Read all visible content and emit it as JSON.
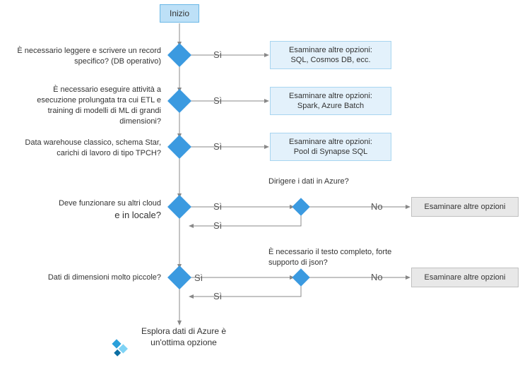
{
  "start": "Inizio",
  "q1": "È necessario leggere e scrivere un record specifico? (DB operativo)",
  "q2": "È necessario eseguire attività a esecuzione prolungata tra cui ETL e training di modelli di ML di grandi dimensioni?",
  "q3": "Data warehouse classico, schema Star, carichi di lavoro di tipo TPCH?",
  "q4_l1": "Deve funzionare su altri cloud",
  "q4_l2": "e in locale?",
  "q4b": "Dirigere i dati in Azure?",
  "q5": "Dati di dimensioni molto piccole?",
  "q5b": "È necessario il testo completo, forte supporto di json?",
  "a1_l1": "Esaminare altre opzioni:",
  "a1_l2": "SQL, Cosmos DB, ecc.",
  "a2_l1": "Esaminare altre opzioni:",
  "a2_l2": "Spark, Azure Batch",
  "a3_l1": "Esaminare altre opzioni:",
  "a3_l2": "Pool di Synapse SQL",
  "a_other": "Esaminare altre opzioni",
  "final_l1": "Esplora dati di Azure è",
  "final_l2": "un'ottima opzione",
  "yes": "Sì",
  "no": "No",
  "chart_data": {
    "type": "flowchart",
    "nodes": [
      {
        "id": "start",
        "type": "start",
        "label": "Inizio"
      },
      {
        "id": "d1",
        "type": "decision",
        "label": "È necessario leggere e scrivere un record specifico? (DB operativo)"
      },
      {
        "id": "a1",
        "type": "process",
        "label": "Esaminare altre opzioni: SQL, Cosmos DB, ecc."
      },
      {
        "id": "d2",
        "type": "decision",
        "label": "È necessario eseguire attività a esecuzione prolungata tra cui ETL e training di modelli di ML di grandi dimensioni?"
      },
      {
        "id": "a2",
        "type": "process",
        "label": "Esaminare altre opzioni: Spark, Azure Batch"
      },
      {
        "id": "d3",
        "type": "decision",
        "label": "Data warehouse classico, schema Star, carichi di lavoro di tipo TPCH?"
      },
      {
        "id": "a3",
        "type": "process",
        "label": "Esaminare altre opzioni: Pool di Synapse SQL"
      },
      {
        "id": "d4",
        "type": "decision",
        "label": "Deve funzionare su altri cloud e in locale?"
      },
      {
        "id": "d4b",
        "type": "decision",
        "label": "Dirigere i dati in Azure?"
      },
      {
        "id": "a4",
        "type": "process",
        "label": "Esaminare altre opzioni"
      },
      {
        "id": "d5",
        "type": "decision",
        "label": "Dati di dimensioni molto piccole?"
      },
      {
        "id": "d5b",
        "type": "decision",
        "label": "È necessario il testo completo, forte supporto di json?"
      },
      {
        "id": "a5",
        "type": "process",
        "label": "Esaminare altre opzioni"
      },
      {
        "id": "end",
        "type": "end",
        "label": "Esplora dati di Azure è un'ottima opzione"
      }
    ],
    "edges": [
      {
        "from": "start",
        "to": "d1"
      },
      {
        "from": "d1",
        "to": "a1",
        "label": "Sì"
      },
      {
        "from": "d1",
        "to": "d2"
      },
      {
        "from": "d2",
        "to": "a2",
        "label": "Sì"
      },
      {
        "from": "d2",
        "to": "d3"
      },
      {
        "from": "d3",
        "to": "a3",
        "label": "Sì"
      },
      {
        "from": "d3",
        "to": "d4"
      },
      {
        "from": "d4",
        "to": "d4b",
        "label": "Sì"
      },
      {
        "from": "d4b",
        "to": "a4",
        "label": "No"
      },
      {
        "from": "d4b",
        "to": "d5",
        "label": "Sì"
      },
      {
        "from": "d4",
        "to": "d5"
      },
      {
        "from": "d5",
        "to": "d5b",
        "label": "Sì"
      },
      {
        "from": "d5b",
        "to": "a5",
        "label": "No"
      },
      {
        "from": "d5b",
        "to": "end",
        "label": "Sì"
      },
      {
        "from": "d5",
        "to": "end"
      }
    ]
  }
}
